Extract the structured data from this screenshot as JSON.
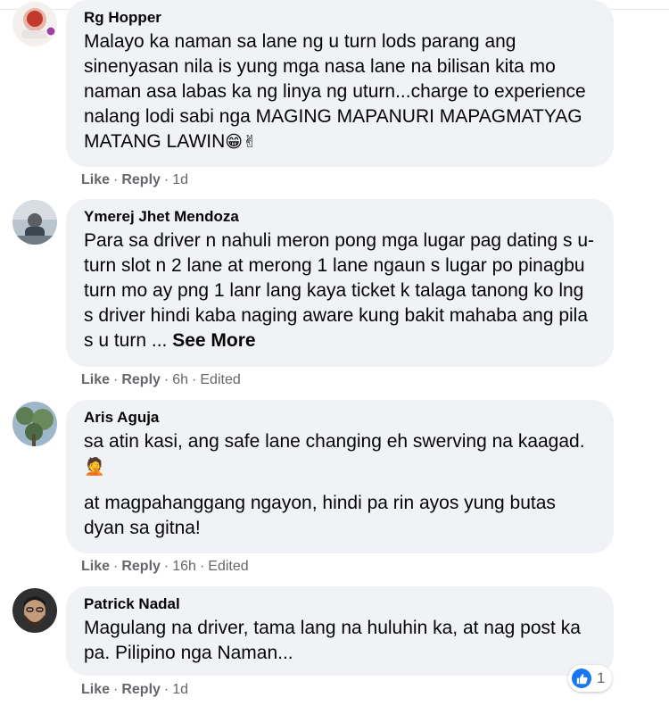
{
  "colors": {
    "bubble_bg": "#f0f2f5",
    "meta_text": "#65676b",
    "like_blue": "#1877f2"
  },
  "comments": [
    {
      "author": "Rg Hopper",
      "text": "Malayo ka naman sa lane ng u turn lods parang ang sinenyasan nila is yung mga nasa lane na bilisan kita mo naman asa labas ka ng linya ng uturn...charge to experience nalang lodi sabi nga MAGING MAPANURI MAPAGMATYAG MATANG LAWIN",
      "emoji": "😁✌",
      "like": "Like",
      "reply": "Reply",
      "time": "1d"
    },
    {
      "author": "Ymerej Jhet Mendoza",
      "text": "Para sa driver n nahuli meron pong mga lugar pag dating s u-turn slot n 2 lane at merong 1 lane ngaun s lugar po pinagbu turn mo ay png 1 lanr lang kaya ticket k talaga tanong ko lng s driver hindi kaba naging aware kung bakit mahaba ang pila s u turn ...",
      "see_more": "See More",
      "like": "Like",
      "reply": "Reply",
      "time": "6h",
      "edited": "Edited"
    },
    {
      "author": "Aris Aguja",
      "text_1": "sa atin kasi, ang safe lane changing eh swerving na kaagad.",
      "emoji": "🤦",
      "text_2": "at magpahanggang ngayon, hindi pa rin ayos yung butas dyan sa gitna!",
      "like": "Like",
      "reply": "Reply",
      "time": "16h",
      "edited": "Edited"
    },
    {
      "author": "Patrick Nadal",
      "text": "Magulang na driver, tama lang na huluhin ka, at nag post ka pa. Pilipino nga Naman...",
      "like": "Like",
      "reply": "Reply",
      "time": "1d",
      "reaction_count": "1"
    }
  ]
}
